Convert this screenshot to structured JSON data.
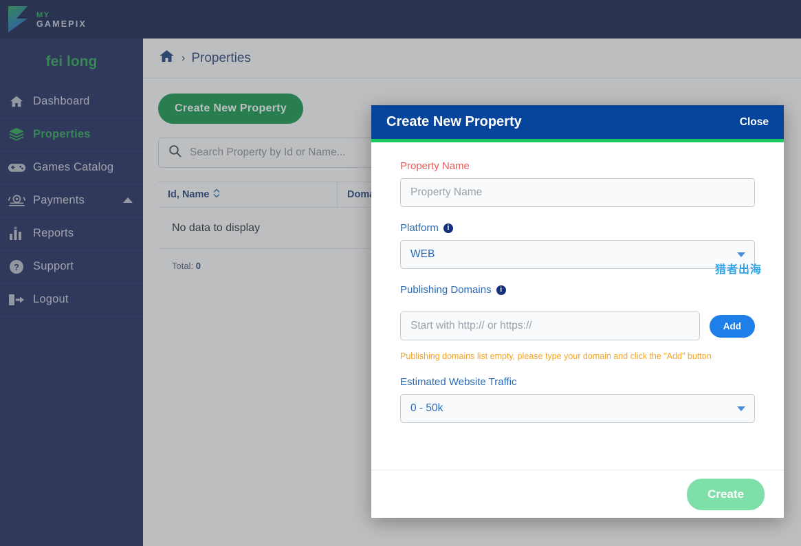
{
  "brand": {
    "logo_line1": "MY",
    "logo_line2": "GAMEPIX",
    "accent_green": "#1fa34f",
    "sidebar_bg": "#142159",
    "topbar_bg": "#0a1a48"
  },
  "sidebar": {
    "user_name": "fei long",
    "items": [
      {
        "label": "Dashboard",
        "icon": "home-icon",
        "active": false
      },
      {
        "label": "Properties",
        "icon": "layers-icon",
        "active": true
      },
      {
        "label": "Games Catalog",
        "icon": "gamepad-icon",
        "active": false
      },
      {
        "label": "Payments",
        "icon": "coins-icon",
        "active": false,
        "chevron": "chevron-up-icon"
      },
      {
        "label": "Reports",
        "icon": "bar-chart-icon",
        "active": false
      },
      {
        "label": "Support",
        "icon": "question-icon",
        "active": false
      },
      {
        "label": "Logout",
        "icon": "logout-icon",
        "active": false
      }
    ]
  },
  "breadcrumb": {
    "home_icon": "home-icon",
    "separator": "›",
    "current": "Properties"
  },
  "main": {
    "create_button": "Create New Property",
    "search": {
      "icon": "search-icon",
      "placeholder": "Search Property by Id or Name...",
      "value": ""
    },
    "table": {
      "columns": [
        "Id, Name",
        "Domains"
      ],
      "sort_icon": "sort-arrows-icon",
      "empty_message": "No data to display",
      "total_label": "Total:",
      "total_value": "0"
    }
  },
  "modal": {
    "title": "Create New Property",
    "close_label": "Close",
    "header_bg": "#06459b",
    "accent_bar": "#1bc95e",
    "fields": {
      "property_name": {
        "label": "Property Name",
        "label_state": "error",
        "placeholder": "Property Name",
        "value": ""
      },
      "platform": {
        "label": "Platform",
        "info_icon": "info-icon",
        "selected": "WEB",
        "caret": "chevron-down-icon"
      },
      "publishing_domains": {
        "label": "Publishing Domains",
        "info_icon": "info-icon",
        "placeholder": "Start with http:// or https://",
        "value": "",
        "add_button": "Add",
        "warning": "Publishing domains list empty, please type your domain and click the \"Add\" button"
      },
      "estimated_traffic": {
        "label": "Estimated Website Traffic",
        "selected": "0 - 50k",
        "caret": "chevron-down-icon"
      }
    },
    "submit_button": "Create"
  },
  "watermark": {
    "text": "猎者出海",
    "color": "#2aa3e8"
  }
}
